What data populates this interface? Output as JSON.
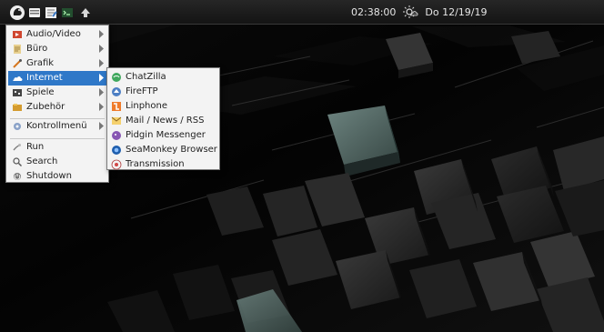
{
  "taskbar": {
    "clock": "02:38:00",
    "date": "Do 12/19/19"
  },
  "start_menu": {
    "items": [
      {
        "label": "Audio/Video"
      },
      {
        "label": "Büro"
      },
      {
        "label": "Grafik"
      },
      {
        "label": "Internet"
      },
      {
        "label": "Spiele"
      },
      {
        "label": "Zubehör"
      },
      {
        "label": "Kontrollmenü"
      },
      {
        "label": "Run"
      },
      {
        "label": "Search"
      },
      {
        "label": "Shutdown"
      }
    ]
  },
  "internet_submenu": {
    "items": [
      {
        "label": "ChatZilla"
      },
      {
        "label": "FireFTP"
      },
      {
        "label": "Linphone"
      },
      {
        "label": "Mail / News / RSS"
      },
      {
        "label": "Pidgin Messenger"
      },
      {
        "label": "SeaMonkey Browser"
      },
      {
        "label": "Transmission"
      }
    ]
  }
}
